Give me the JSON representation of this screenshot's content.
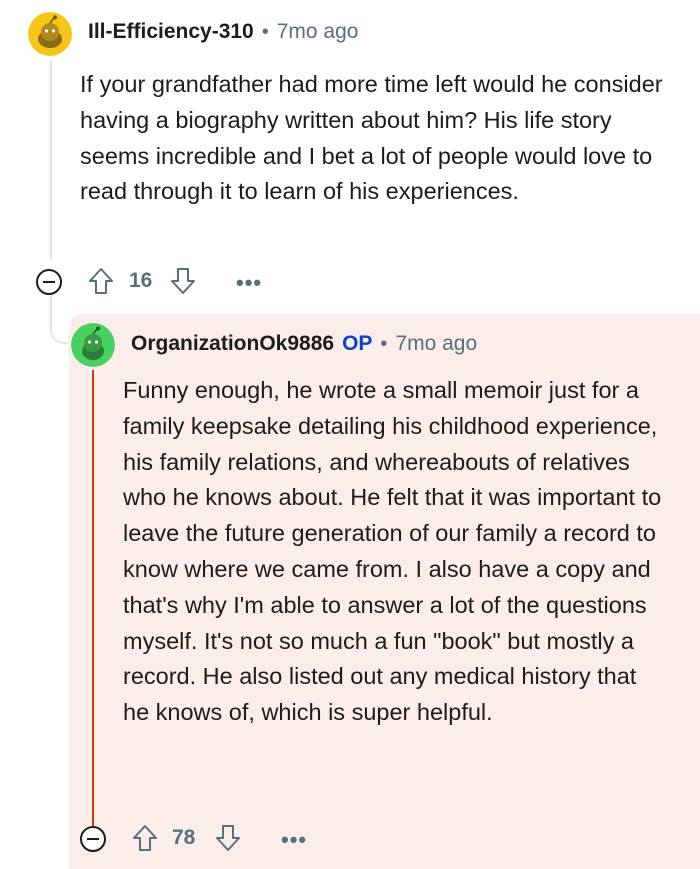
{
  "comment": {
    "username": "Ill-Efficiency-310",
    "separator": "•",
    "time": "7mo ago",
    "body": "If your grandfather had more time left would he consider having a biography written about him? His life story seems incredible and I bet a lot of people would love to read through it to learn of his experiences.",
    "score": "16",
    "more": "•••",
    "avatar_color": "#f5c518"
  },
  "reply": {
    "username": "OrganizationOk9886",
    "op_badge": "OP",
    "separator": "•",
    "time": "7mo ago",
    "body": "Funny enough, he wrote a small memoir just for a family keepsake detailing his childhood experience, his family relations, and whereabouts of relatives who he knows about. He felt that it was important to leave the future generation of our family a record to know where we came from. I also have a copy and that's why I'm able to answer a lot of the questions myself. It's not so much a fun \"book\" but mostly a record. He also listed out any medical history that he knows of, which is super helpful.",
    "score": "78",
    "more": "•••",
    "avatar_color": "#46d160",
    "highlight_color": "#fbeeea",
    "op_bar_color": "#d93a00"
  }
}
